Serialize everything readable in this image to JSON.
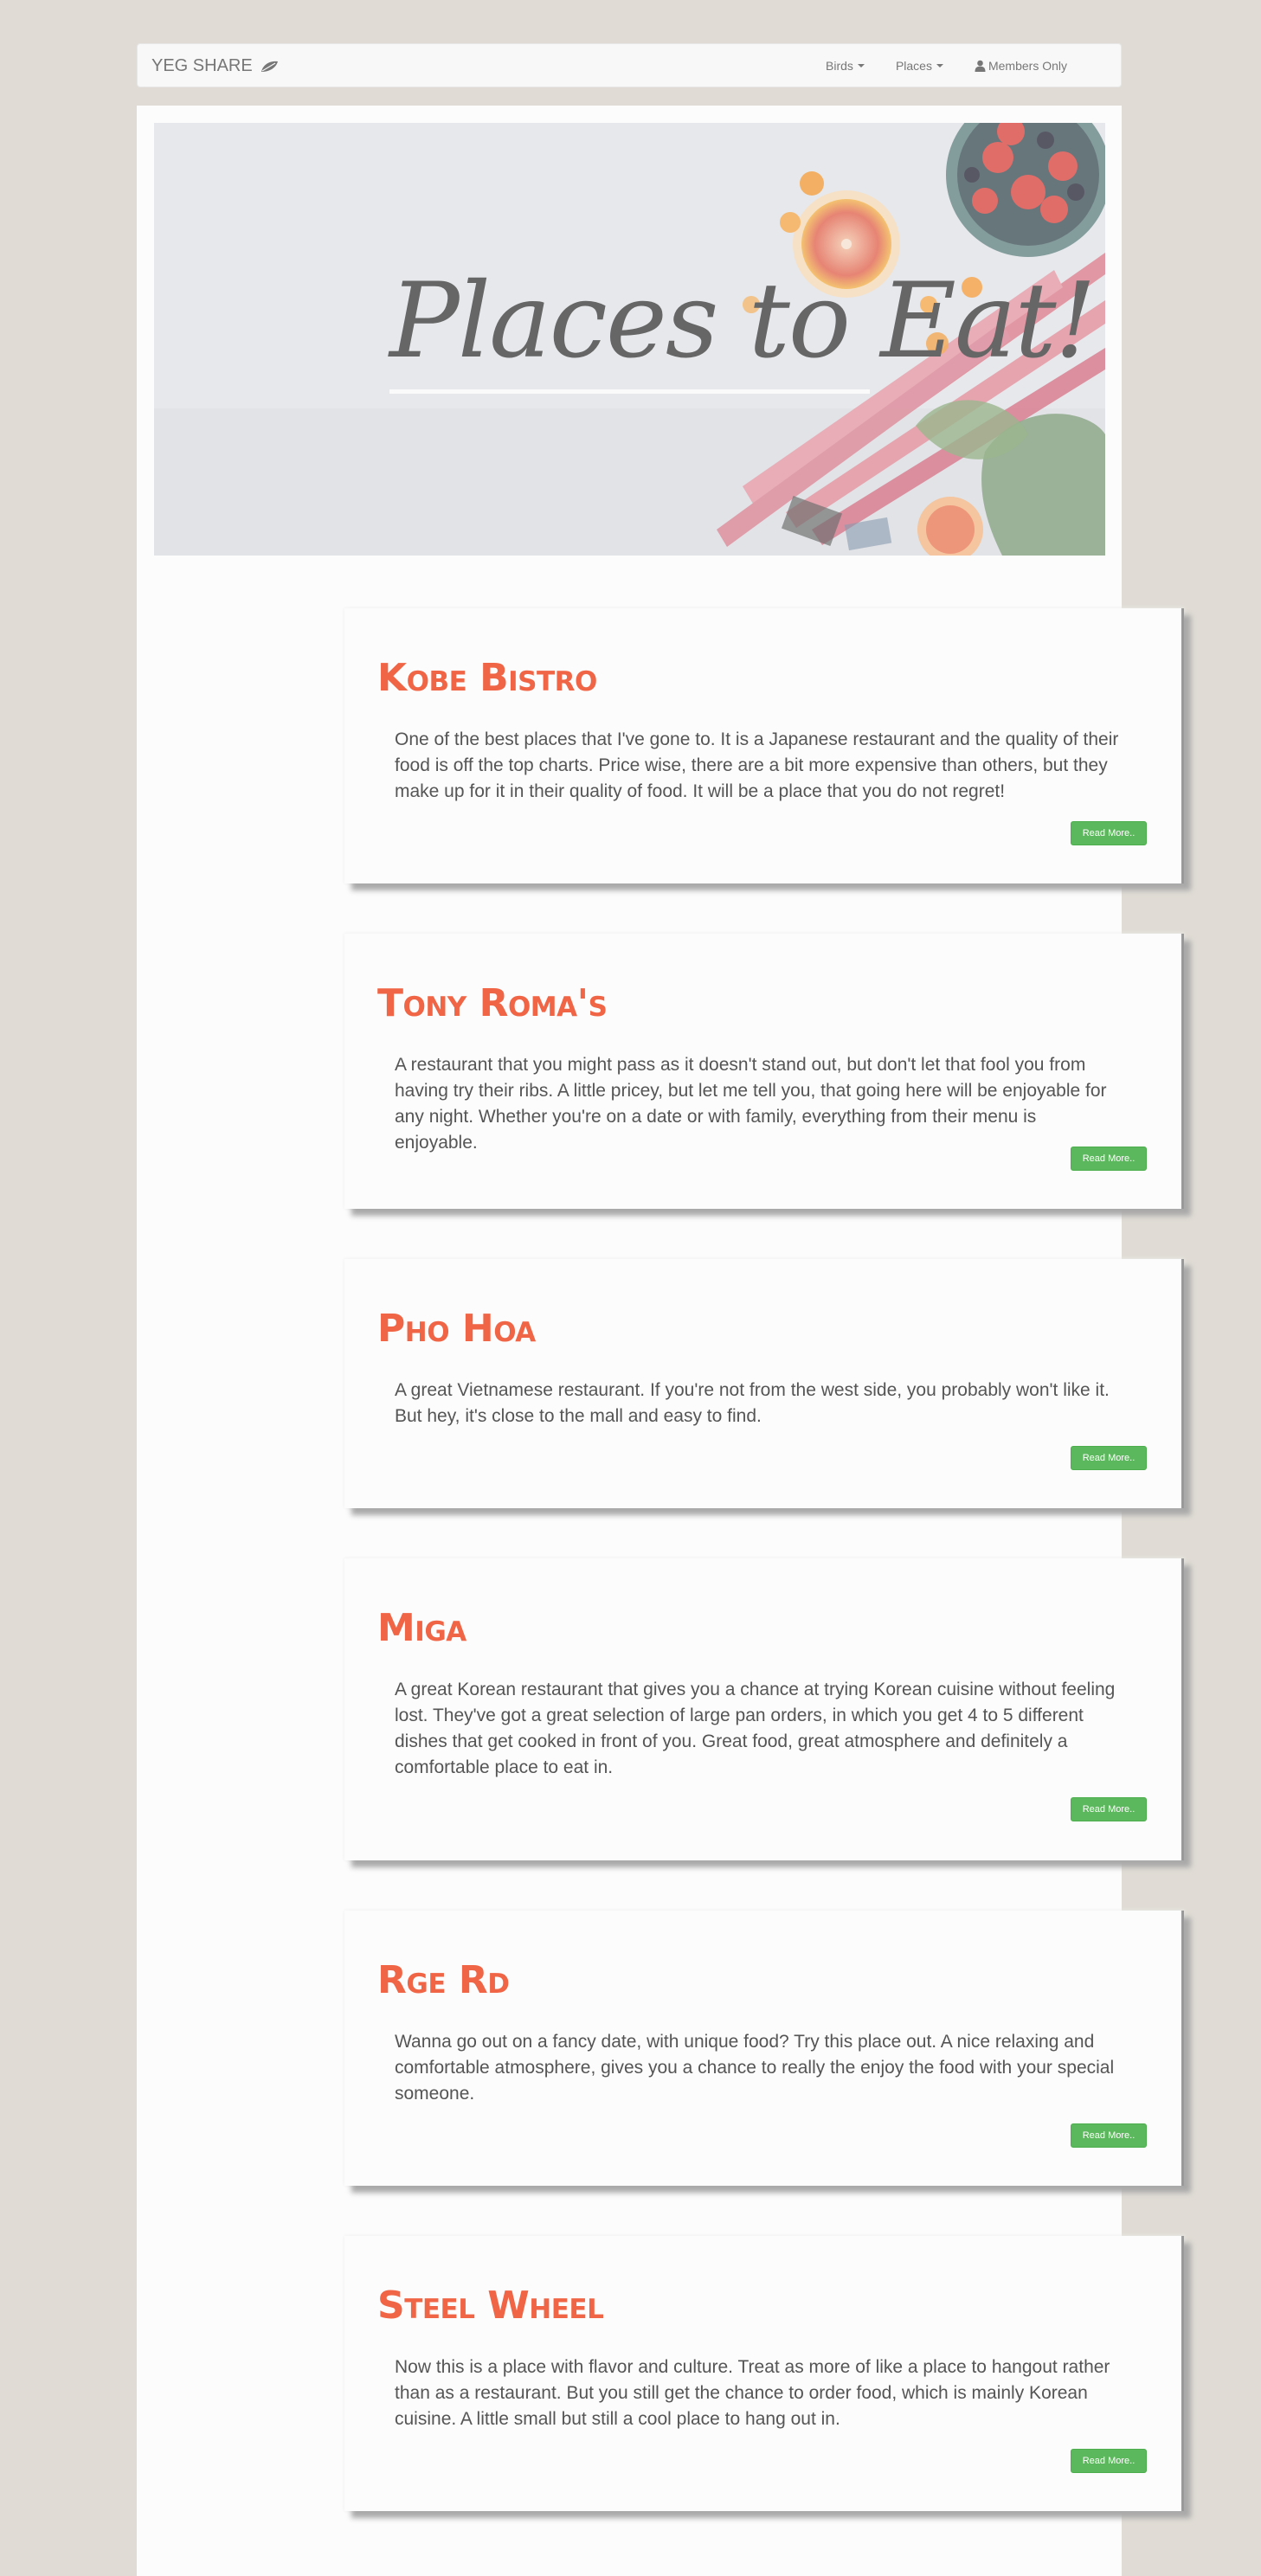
{
  "navbar": {
    "brand": "YEG SHARE",
    "links": [
      {
        "label": "Birds"
      },
      {
        "label": "Places"
      },
      {
        "label": "Members Only"
      }
    ]
  },
  "hero": {
    "title": "Places to Eat!"
  },
  "cards": [
    {
      "title": "Kobe Bistro",
      "text": "One of the best places that I've gone to. It is a Japanese restaurant and the quality of their food is off the top charts. Price wise, there are a bit more expensive than others, but they make up for it in their quality of food. It will be a place that you do not regret!",
      "button": "Read More.."
    },
    {
      "title": "Tony Roma's",
      "text": "A restaurant that you might pass as it doesn't stand out, but don't let that fool you from having try their ribs. A little pricey, but let me tell you, that going here will be enjoyable for any night. Whether you're on a date or with family, everything from their menu is enjoyable.",
      "button": "Read More.."
    },
    {
      "title": "Pho Hoa",
      "text": "A great Vietnamese restaurant. If you're not from the west side, you probably won't like it. But hey, it's close to the mall and easy to find.",
      "button": "Read More.."
    },
    {
      "title": "Miga",
      "text": "A great Korean restaurant that gives you a chance at trying Korean cuisine without feeling lost. They've got a great selection of large pan orders, in which you get 4 to 5 different dishes that get cooked in front of you. Great food, great atmosphere and definitely a comfortable place to eat in.",
      "button": "Read More.."
    },
    {
      "title": "Rge Rd",
      "text": "Wanna go out on a fancy date, with unique food? Try this place out. A nice relaxing and comfortable atmosphere, gives you a chance to really the enjoy the food with your special someone.",
      "button": "Read More.."
    },
    {
      "title": "Steel Wheel",
      "text": "Now this is a place with flavor and culture. Treat as more of like a place to hangout rather than as a restaurant. But you still get the chance to order food, which is mainly Korean cuisine. A little small but still a cool place to hang out in.",
      "button": "Read More.."
    }
  ],
  "colors": {
    "page_bg": "#e0dcd5",
    "title_accent": "#f06545",
    "button_green": "#5cb85c"
  }
}
